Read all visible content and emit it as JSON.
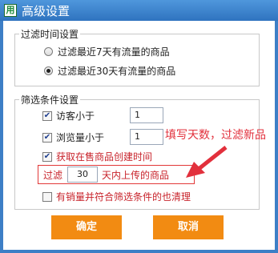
{
  "window": {
    "title": "高级设置",
    "app_icon_text": "用"
  },
  "time_filter": {
    "group_label": "过滤时间设置",
    "options": [
      "过滤最近7天有流量的商品",
      "过滤最近30天有流量的商品"
    ],
    "selected_index": 1
  },
  "conditions": {
    "group_label": "筛选条件设置",
    "visitors": {
      "label": "访客小于",
      "checked": true,
      "value": "1"
    },
    "views": {
      "label": "浏览量小于",
      "checked": true,
      "value": "1"
    },
    "creation_time": {
      "label": "获取在售商品创建时间",
      "checked": true
    },
    "days_prefix": "过滤",
    "days_value": "30",
    "days_suffix": "天内上传的商品",
    "also_clear": {
      "label": "有销量并符合筛选条件的也清理",
      "checked": false
    }
  },
  "annotation": {
    "text": "填写天数，过滤新品",
    "color": "#e2303c"
  },
  "buttons": {
    "ok": "确定",
    "cancel": "取消",
    "color": "#f28b12"
  }
}
